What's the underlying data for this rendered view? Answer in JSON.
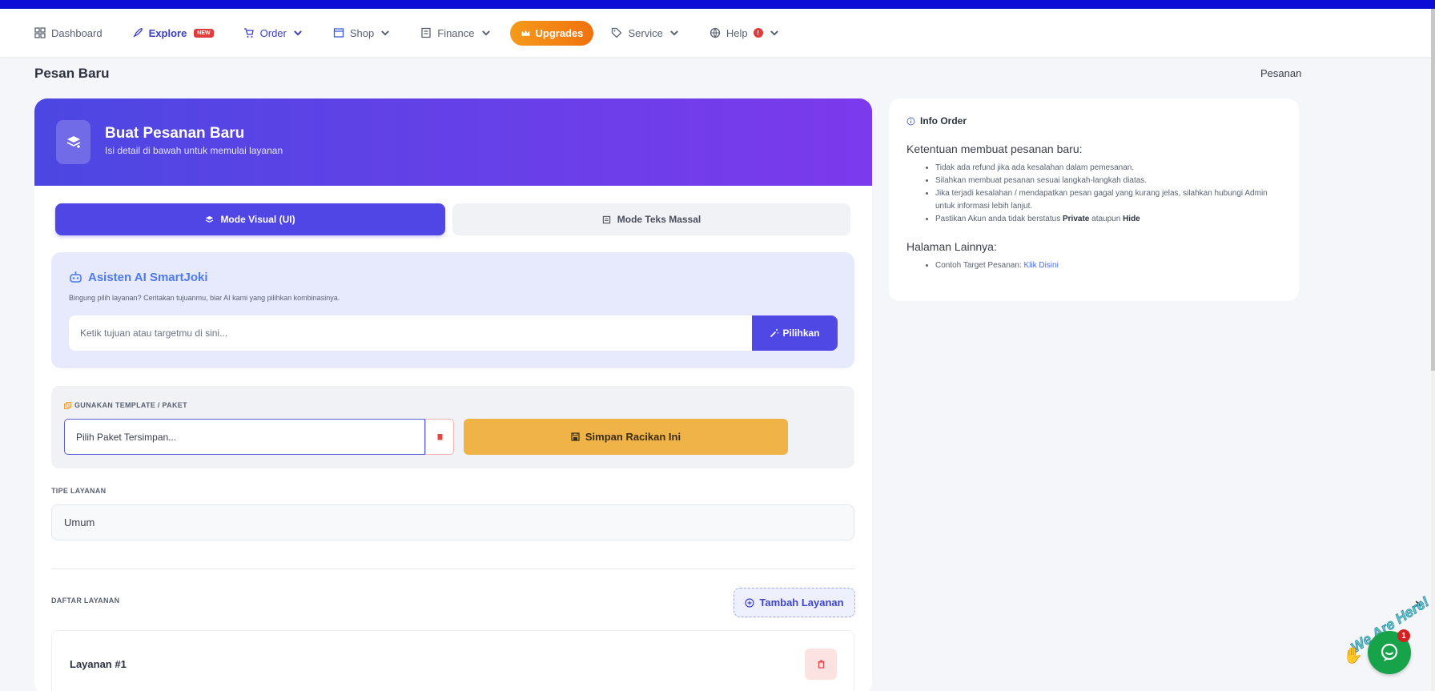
{
  "nav": {
    "dashboard": "Dashboard",
    "explore": "Explore",
    "explore_badge": "NEW",
    "order": "Order",
    "shop": "Shop",
    "finance": "Finance",
    "upgrades": "Upgrades",
    "service": "Service",
    "help": "Help",
    "help_badge": "!"
  },
  "page": {
    "title": "Pesan Baru",
    "breadcrumb": "Pesanan"
  },
  "hero": {
    "title": "Buat Pesanan Baru",
    "subtitle": "Isi detail di bawah untuk memulai layanan"
  },
  "tabs": {
    "visual": "Mode Visual (UI)",
    "text": "Mode Teks Massal"
  },
  "ai": {
    "title": "Asisten AI SmartJoki",
    "subtitle": "Bingung pilih layanan? Ceritakan tujuanmu, biar AI kami yang pilihkan kombinasinya.",
    "placeholder": "Ketik tujuan atau targetmu di sini...",
    "button": "Pilihkan"
  },
  "template": {
    "label": "GUNAKAN TEMPLATE / PAKET",
    "select_placeholder": "Pilih Paket Tersimpan...",
    "save_button": "Simpan Racikan Ini"
  },
  "service_type": {
    "label": "TIPE LAYANAN",
    "value": "Umum"
  },
  "service_list": {
    "label": "DAFTAR LAYANAN",
    "add_button": "Tambah Layanan",
    "item_title": "Layanan #1"
  },
  "info": {
    "title": "Info Order",
    "rules_heading": "Ketentuan membuat pesanan baru:",
    "rule1": "Tidak ada refund jika ada kesalahan dalam pemesanan.",
    "rule2": "Silahkan membuat pesanan sesuai langkah-langkah diatas.",
    "rule3": "Jika terjadi kesalahan / mendapatkan pesan gagal yang kurang jelas, silahkan hubungi Admin untuk informasi lebih lanjut.",
    "rule4_pre": "Pastikan Akun anda tidak berstatus ",
    "rule4_private": "Private",
    "rule4_mid": " ataupun ",
    "rule4_hide": "Hide",
    "other_heading": "Halaman Lainnya:",
    "other_item": "Contoh Target Pesanan: ",
    "other_link": "Klik Disini"
  },
  "chat": {
    "label": "We Are Here!",
    "badge": "1",
    "close": "×"
  },
  "colors": {
    "primary": "#4f46e5",
    "accent": "#f0b347",
    "upgrade": "#f0720e",
    "topbar": "#0c0cd6"
  }
}
